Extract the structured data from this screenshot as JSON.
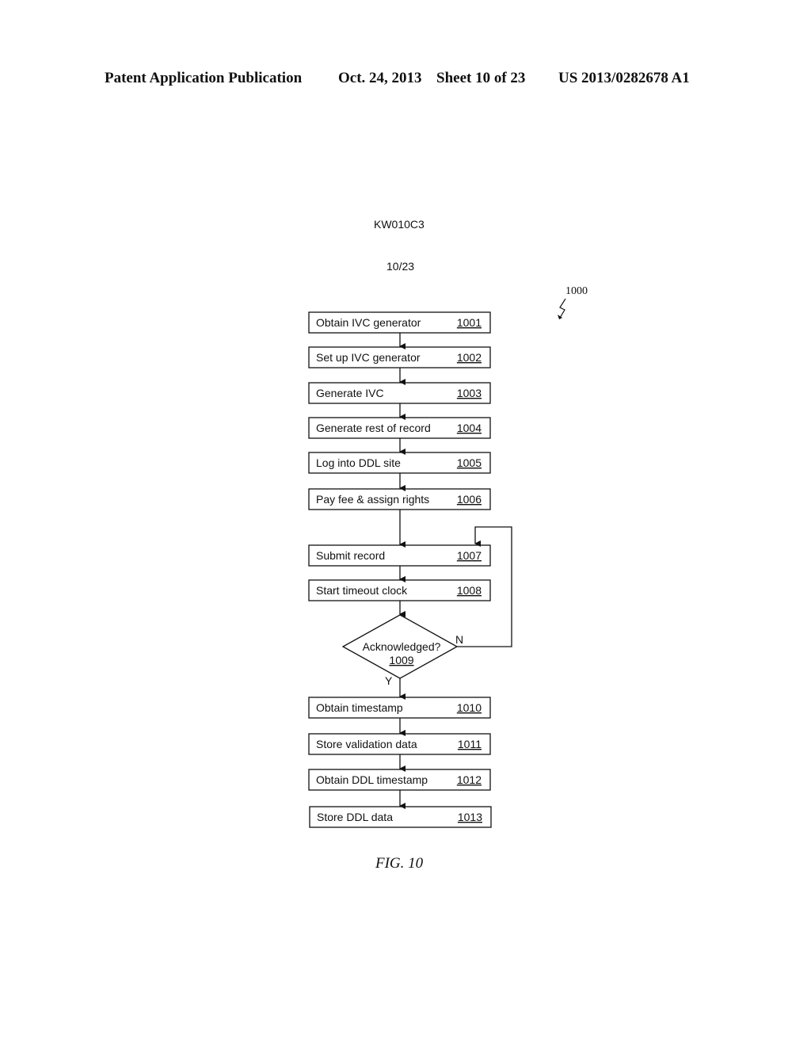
{
  "header": {
    "publication_type": "Patent Application Publication",
    "date": "Oct. 24, 2013",
    "sheet": "Sheet 10 of 23",
    "publication_number": "US 2013/0282678 A1"
  },
  "drawing": {
    "code": "KW010C3",
    "sheet_number": "10/23",
    "reference_number": "1000",
    "caption": "FIG. 10"
  },
  "flowchart": {
    "steps": [
      {
        "label": "Obtain IVC generator",
        "number": "1001"
      },
      {
        "label": "Set up IVC generator",
        "number": "1002"
      },
      {
        "label": "Generate IVC",
        "number": "1003"
      },
      {
        "label": "Generate rest of record",
        "number": "1004"
      },
      {
        "label": "Log into DDL site",
        "number": "1005"
      },
      {
        "label": "Pay fee & assign rights",
        "number": "1006"
      },
      {
        "label": "Submit record",
        "number": "1007"
      },
      {
        "label": "Start timeout clock",
        "number": "1008"
      },
      {
        "label": "Obtain timestamp",
        "number": "1010"
      },
      {
        "label": "Store validation data",
        "number": "1011"
      },
      {
        "label": "Obtain DDL timestamp",
        "number": "1012"
      },
      {
        "label": "Store DDL data",
        "number": "1013"
      }
    ],
    "decision": {
      "label": "Acknowledged?",
      "number": "1009",
      "yes_label": "Y",
      "no_label": "N"
    }
  }
}
